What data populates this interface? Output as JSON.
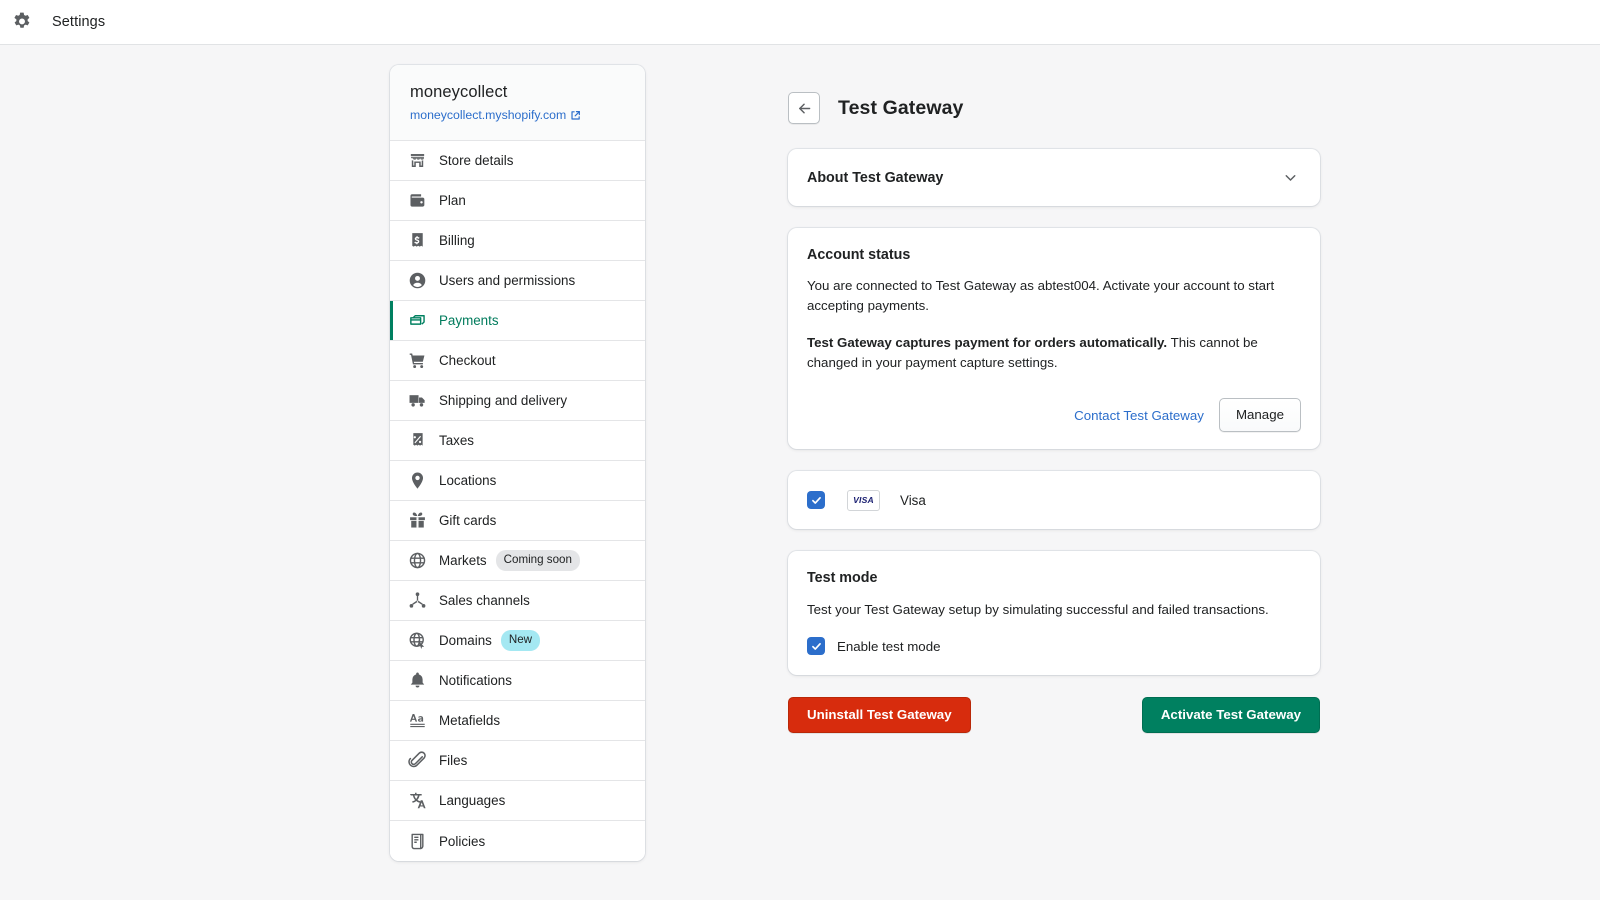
{
  "topbar": {
    "icon": "gear-icon",
    "title": "Settings"
  },
  "sidebar": {
    "store_name": "moneycollect",
    "store_url": "moneycollect.myshopify.com",
    "external_link_icon": "external-link-icon",
    "items": [
      {
        "label": "Store details",
        "icon": "store-icon",
        "active": false
      },
      {
        "label": "Plan",
        "icon": "wallet-icon",
        "active": false
      },
      {
        "label": "Billing",
        "icon": "receipt-dollar-icon",
        "active": false
      },
      {
        "label": "Users and permissions",
        "icon": "person-circle-icon",
        "active": false
      },
      {
        "label": "Payments",
        "icon": "payment-card-icon",
        "active": true
      },
      {
        "label": "Checkout",
        "icon": "shopping-cart-icon",
        "active": false
      },
      {
        "label": "Shipping and delivery",
        "icon": "delivery-truck-icon",
        "active": false
      },
      {
        "label": "Taxes",
        "icon": "percent-receipt-icon",
        "active": false
      },
      {
        "label": "Locations",
        "icon": "map-pin-icon",
        "active": false
      },
      {
        "label": "Gift cards",
        "icon": "gift-icon",
        "active": false
      },
      {
        "label": "Markets",
        "icon": "globe-icon",
        "active": false,
        "badge": "Coming soon",
        "badge_style": "gray"
      },
      {
        "label": "Sales channels",
        "icon": "channels-icon",
        "active": false
      },
      {
        "label": "Domains",
        "icon": "globe-pointer-icon",
        "active": false,
        "badge": "New",
        "badge_style": "cyan"
      },
      {
        "label": "Notifications",
        "icon": "bell-icon",
        "active": false
      },
      {
        "label": "Metafields",
        "icon": "text-aa-icon",
        "active": false
      },
      {
        "label": "Files",
        "icon": "paperclip-icon",
        "active": false
      },
      {
        "label": "Languages",
        "icon": "translate-icon",
        "active": false
      },
      {
        "label": "Policies",
        "icon": "policy-document-icon",
        "active": false
      }
    ]
  },
  "main": {
    "back_icon": "arrow-left-icon",
    "title": "Test Gateway",
    "about": {
      "title": "About Test Gateway",
      "chevron_icon": "chevron-down-icon"
    },
    "account_status": {
      "title": "Account status",
      "paragraph_1": "You are connected to Test Gateway as abtest004. Activate your account to start accepting payments.",
      "paragraph_2_bold": "Test Gateway captures payment for orders automatically.",
      "paragraph_2_rest": " This cannot be changed in your payment capture settings.",
      "contact_link": "Contact Test Gateway",
      "manage_button": "Manage"
    },
    "payment_method": {
      "checked": true,
      "check_icon": "checkmark-icon",
      "logo_text": "VISA",
      "name": "Visa"
    },
    "test_mode": {
      "title": "Test mode",
      "description": "Test your Test Gateway setup by simulating successful and failed transactions.",
      "checkbox_label": "Enable test mode",
      "checked": true,
      "check_icon": "checkmark-icon"
    },
    "footer": {
      "uninstall_button": "Uninstall Test Gateway",
      "activate_button": "Activate Test Gateway"
    }
  },
  "colors": {
    "accent_green": "#008060",
    "link_blue": "#2c6ecb",
    "danger_red": "#d72c0d",
    "checkbox_blue": "#2c6ecb",
    "badge_cyan": "#a4e8f2",
    "badge_gray": "#e4e5e7",
    "page_background": "#f6f6f7"
  }
}
